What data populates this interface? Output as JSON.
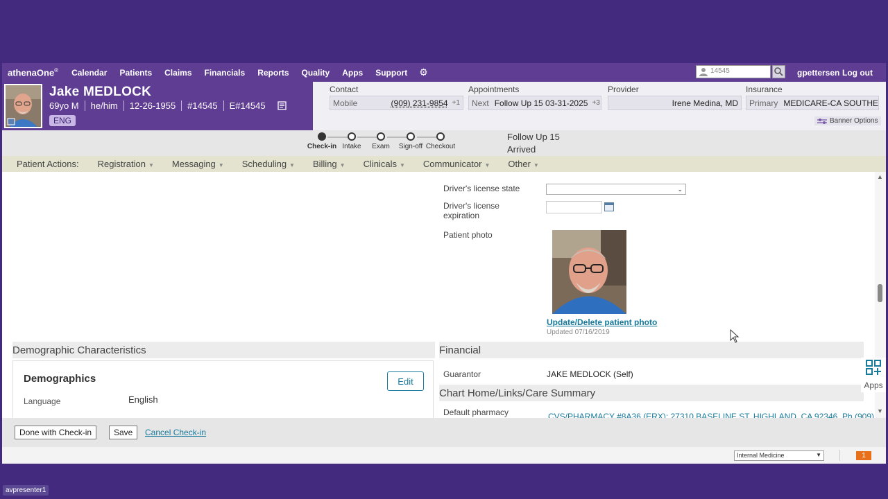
{
  "nav": {
    "brand": "athenaOne",
    "brand_mark": "®",
    "items": [
      "Calendar",
      "Patients",
      "Claims",
      "Financials",
      "Reports",
      "Quality",
      "Apps",
      "Support"
    ],
    "search_value": "14545",
    "user": "gpettersen",
    "logout": "Log out"
  },
  "patient": {
    "name": "Jake MEDLOCK",
    "age_sex": "69yo M",
    "pronouns": "he/him",
    "dob": "12-26-1955",
    "id": "#14545",
    "eid": "E#14545",
    "language_badge": "ENG"
  },
  "banner": {
    "contact_label": "Contact",
    "contact_type": "Mobile",
    "contact_value": "(909) 231-9854",
    "contact_more": "+1",
    "appointments_label": "Appointments",
    "appt_key": "Next",
    "appt_value": "Follow Up 15 03-31-2025",
    "appt_more": "+3",
    "provider_label": "Provider",
    "provider_value": "Irene Medina, MD",
    "insurance_label": "Insurance",
    "insurance_key": "Primary",
    "insurance_value": "MEDICARE-CA SOUTHE...",
    "options": "Banner Options"
  },
  "workflow": {
    "steps": [
      "Check-in",
      "Intake",
      "Exam",
      "Sign-off",
      "Checkout"
    ],
    "active_step": "Check-in",
    "appointment_type": "Follow Up 15",
    "appointment_status": "Arrived"
  },
  "actions": {
    "label": "Patient Actions:",
    "menus": [
      "Registration",
      "Messaging",
      "Scheduling",
      "Billing",
      "Clinicals",
      "Communicator",
      "Other"
    ]
  },
  "form": {
    "dl_state_label": "Driver's license state",
    "dl_exp_label_1": "Driver's license",
    "dl_exp_label_2": "expiration",
    "photo_label": "Patient photo",
    "photo_link": "Update/Delete patient photo",
    "photo_updated": "Updated 07/16/2019",
    "demographic_header": "Demographic Characteristics",
    "demographics_title": "Demographics",
    "edit": "Edit",
    "language_label": "Language",
    "language_value": "English",
    "financial_header": "Financial",
    "guarantor_label": "Guarantor",
    "guarantor_value": "JAKE MEDLOCK (Self)",
    "chart_header": "Chart Home/Links/Care Summary",
    "pharmacy_label": "Default pharmacy",
    "pharmacy_value": "CVS/PHARMACY #8A36 (ERX): 27310 BASELINE ST, HIGHLAND, CA 92346, Ph (909)"
  },
  "apps_widget": "Apps",
  "footer": {
    "done": "Done with Check-in",
    "save": "Save",
    "cancel": "Cancel Check-in"
  },
  "status": {
    "department": "Internal Medicine",
    "notifications": "1"
  },
  "presenter": "avpresenter1",
  "colors": {
    "outer_bg": "#442a7e",
    "nav_purple": "#5f3d93",
    "actions_bar": "#e3e3cf",
    "link": "#177a9c",
    "notif": "#e8701a"
  }
}
